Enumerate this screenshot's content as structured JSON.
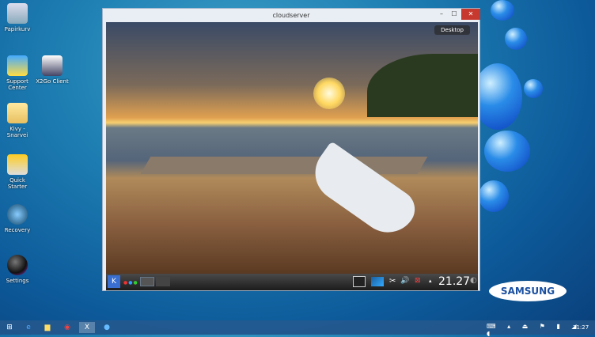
{
  "desktop": {
    "icons": [
      {
        "label": "Papirkurv",
        "icon": "recycle-bin-icon"
      },
      {
        "label": "Support Center",
        "icon": "support-center-icon"
      },
      {
        "label": "X2Go Client",
        "icon": "x2go-icon"
      },
      {
        "label": "Kivy - Snarvei",
        "icon": "folder-icon"
      },
      {
        "label": "Quick Starter",
        "icon": "quick-starter-icon"
      },
      {
        "label": "Recovery",
        "icon": "recovery-icon"
      },
      {
        "label": "Settings",
        "icon": "settings-icon"
      }
    ],
    "brand": "SAMSUNG"
  },
  "window": {
    "title": "cloudserver",
    "desktop_button": "Desktop",
    "clock": "21.27"
  },
  "taskbar": {
    "time": "21:27"
  }
}
